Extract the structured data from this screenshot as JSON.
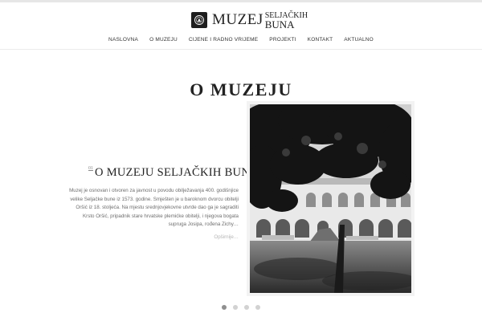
{
  "logo": {
    "word": "MUZEJ",
    "line1": "SELJAČKIH",
    "line2": "BUNA"
  },
  "nav": {
    "items": [
      "NASLOVNA",
      "O MUZEJU",
      "CIJENE I RADNO VRIJEME",
      "PROJEKTI",
      "KONTAKT",
      "AKTUALNO"
    ]
  },
  "page": {
    "title": "O MUZEJU"
  },
  "slide": {
    "number": "01",
    "title": "O MUZEJU SELJAČKIH BUNA",
    "body": "Muzej je osnovan i otvoren za javnost u povodu obilježavanja 400. godišnjice velike Seljačke bune iz 1573. godine. Smješten je u baroknom dvorcu obitelji Oršić iz 18. stoljeća. Na mjestu srednjovjekovne utvrde dao ga je sagraditi Krsto Oršić, pripadnik stare hrvatske plemićke obitelji, i njegova bogata supruga Josipa, rođena Zichy…",
    "more_label": "Opširnije…",
    "image_icon": "courtyard-photo"
  },
  "carousel": {
    "dot_count": 4,
    "active_index": 0
  },
  "colors": {
    "text": "#222222",
    "muted": "#6e6e6e",
    "accent_dot": "#8f8f8f"
  }
}
